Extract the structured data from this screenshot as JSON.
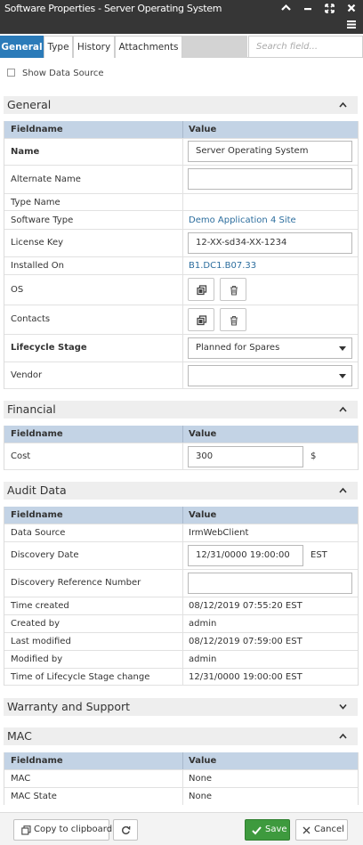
{
  "window": {
    "title": "Software Properties - Server Operating System"
  },
  "tabs": [
    {
      "label": "General"
    },
    {
      "label": "Type"
    },
    {
      "label": "History"
    },
    {
      "label": "Attachments"
    }
  ],
  "search": {
    "placeholder": "Search field..."
  },
  "show_data_source": {
    "label": "Show Data Source",
    "checked": false
  },
  "table_headers": {
    "fieldname": "Fieldname",
    "value": "Value"
  },
  "general": {
    "title": "General",
    "rows": {
      "name": {
        "label": "Name",
        "value": "Server Operating System"
      },
      "alternate_name": {
        "label": "Alternate Name",
        "value": ""
      },
      "type_name": {
        "label": "Type Name",
        "value": ""
      },
      "software_type": {
        "label": "Software Type",
        "value": "Demo Application 4 Site"
      },
      "license_key": {
        "label": "License Key",
        "value": "12-XX-sd34-XX-1234"
      },
      "installed_on": {
        "label": "Installed On",
        "value": "B1.DC1.B07.33"
      },
      "os": {
        "label": "OS"
      },
      "contacts": {
        "label": "Contacts"
      },
      "lifecycle_stage": {
        "label": "Lifecycle Stage",
        "value": "Planned for Spares"
      },
      "vendor": {
        "label": "Vendor",
        "value": ""
      }
    }
  },
  "financial": {
    "title": "Financial",
    "rows": {
      "cost": {
        "label": "Cost",
        "value": "300",
        "unit": "$"
      }
    }
  },
  "audit": {
    "title": "Audit Data",
    "rows": {
      "data_source": {
        "label": "Data Source",
        "value": "IrmWebClient"
      },
      "discovery_date": {
        "label": "Discovery Date",
        "value": "12/31/0000 19:00:00",
        "unit": "EST"
      },
      "discovery_ref": {
        "label": "Discovery Reference Number",
        "value": ""
      },
      "time_created": {
        "label": "Time created",
        "value": "08/12/2019 07:55:20   EST"
      },
      "created_by": {
        "label": "Created by",
        "value": "admin"
      },
      "last_modified": {
        "label": "Last modified",
        "value": "08/12/2019 07:59:00   EST"
      },
      "modified_by": {
        "label": "Modified by",
        "value": "admin"
      },
      "lifecycle_change": {
        "label": "Time of Lifecycle Stage change",
        "value": "12/31/0000 19:00:00   EST"
      }
    }
  },
  "warranty": {
    "title": "Warranty and Support"
  },
  "mac": {
    "title": "MAC",
    "rows": {
      "mac": {
        "label": "MAC",
        "value": "None"
      },
      "mac_state": {
        "label": "MAC State",
        "value": "None"
      }
    }
  },
  "footer": {
    "copy_label": "Copy to clipboard",
    "save_label": "Save",
    "cancel_label": "Cancel"
  },
  "colors": {
    "accent": "#2b7bb9",
    "titlebar": "#363636",
    "table_header": "#c3d3e5",
    "save": "#3e9a3e",
    "link": "#2d6e9e"
  }
}
